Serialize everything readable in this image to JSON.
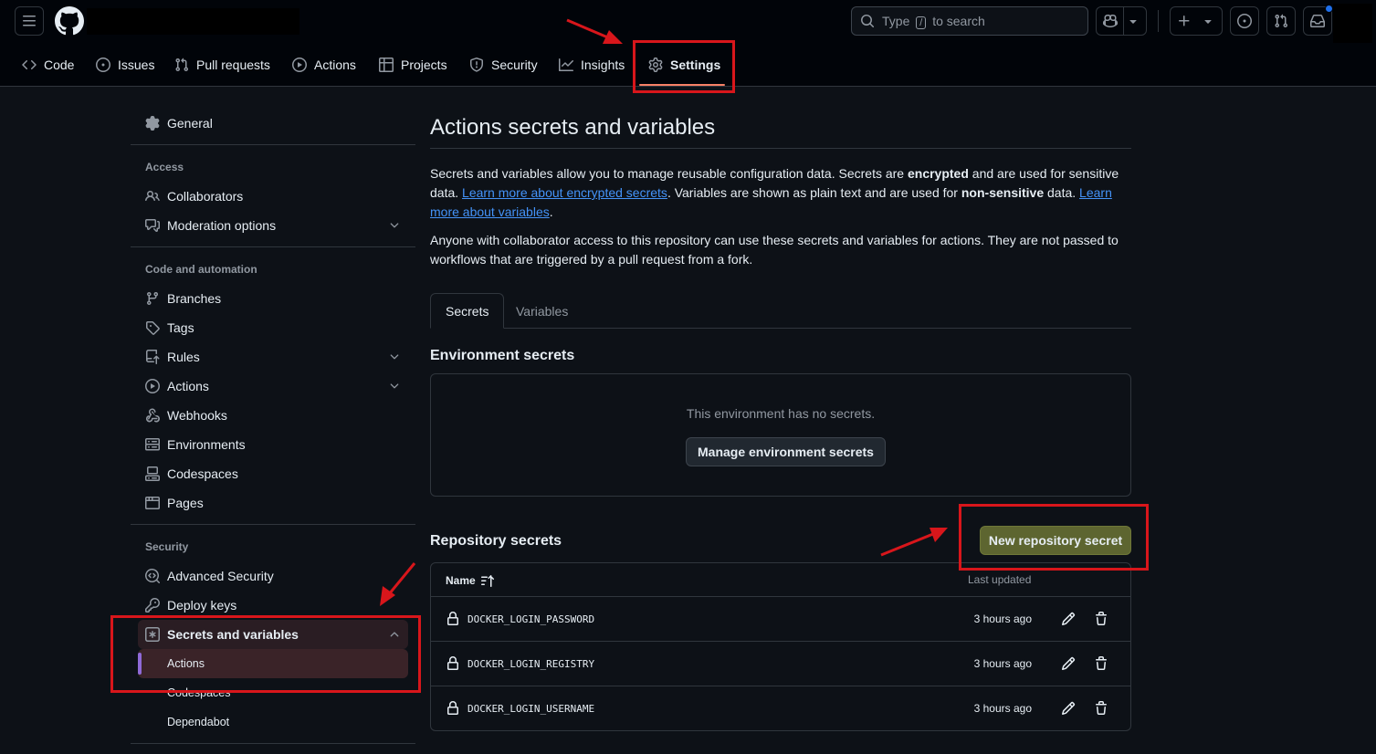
{
  "header": {
    "search_prefix": "Type",
    "search_key": "/",
    "search_suffix": "to search"
  },
  "repo_nav": {
    "items": [
      {
        "label": "Code",
        "icon": "code-icon"
      },
      {
        "label": "Issues",
        "icon": "issue-opened-icon"
      },
      {
        "label": "Pull requests",
        "icon": "git-pull-request-icon"
      },
      {
        "label": "Actions",
        "icon": "play-icon"
      },
      {
        "label": "Projects",
        "icon": "table-icon"
      },
      {
        "label": "Security",
        "icon": "shield-icon"
      },
      {
        "label": "Insights",
        "icon": "graph-icon"
      },
      {
        "label": "Settings",
        "icon": "gear-icon",
        "selected": true
      }
    ]
  },
  "sidebar": {
    "general": "General",
    "access_heading": "Access",
    "collaborators": "Collaborators",
    "moderation": "Moderation options",
    "code_heading": "Code and automation",
    "branches": "Branches",
    "tags": "Tags",
    "rules": "Rules",
    "actions": "Actions",
    "webhooks": "Webhooks",
    "environments": "Environments",
    "codespaces": "Codespaces",
    "pages": "Pages",
    "security_heading": "Security",
    "advanced_security": "Advanced Security",
    "deploy_keys": "Deploy keys",
    "secrets_and_variables": "Secrets and variables",
    "sub_actions": "Actions",
    "sub_codespaces": "Codespaces",
    "sub_dependabot": "Dependabot"
  },
  "main": {
    "title": "Actions secrets and variables",
    "p1_a": "Secrets and variables allow you to manage reusable configuration data. Secrets are ",
    "p1_b": "encrypted",
    "p1_c": " and are used for sensitive data. ",
    "p1_link1": "Learn more about encrypted secrets",
    "p1_d": ". Variables are shown as plain text and are used for ",
    "p1_e": "non-sensitive",
    "p1_f": " data. ",
    "p1_link2": "Learn more about variables",
    "p1_g": ".",
    "p2": "Anyone with collaborator access to this repository can use these secrets and variables for actions. They are not passed to workflows that are triggered by a pull request from a fork.",
    "tab_secrets": "Secrets",
    "tab_variables": "Variables",
    "env_title": "Environment secrets",
    "env_empty": "This environment has no secrets.",
    "env_button": "Manage environment secrets",
    "repo_title": "Repository secrets",
    "new_secret_button": "New repository secret",
    "col_name": "Name",
    "col_updated": "Last updated",
    "secrets": [
      {
        "name": "DOCKER_LOGIN_PASSWORD",
        "updated": "3 hours ago"
      },
      {
        "name": "DOCKER_LOGIN_REGISTRY",
        "updated": "3 hours ago"
      },
      {
        "name": "DOCKER_LOGIN_USERNAME",
        "updated": "3 hours ago"
      }
    ]
  },
  "colors": {
    "accent_link": "#4493f8",
    "primary_button": "#5d6530",
    "annotation_red": "#d8161b",
    "nav_underline": "#f78166"
  }
}
